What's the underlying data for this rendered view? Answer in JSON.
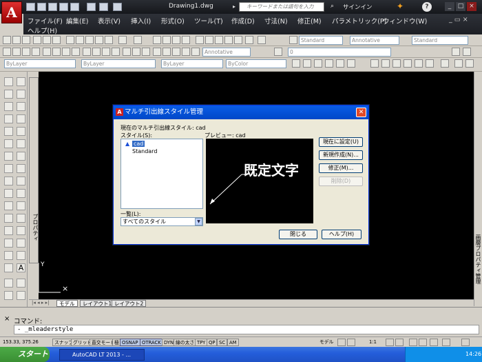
{
  "app": {
    "doc_title": "Drawing1.dwg",
    "search_placeholder": "キーワードまたは語句を入力",
    "signin": "サインイン",
    "logo_letter": "A"
  },
  "menu": {
    "items": [
      "ファイル(F)",
      "編集(E)",
      "表示(V)",
      "挿入(I)",
      "形式(O)",
      "ツール(T)",
      "作成(D)",
      "寸法(N)",
      "修正(M)",
      "パラメトリック(P)",
      "ウィンドウ(W)",
      "ヘルプ(H)"
    ]
  },
  "toolbars": {
    "styles": [
      "Standard",
      "Annotative",
      "Standard"
    ],
    "annotative_label": "Annotative",
    "layer_value": "0",
    "bylayer1": "ByLayer",
    "bylayer2": "ByLayer",
    "bylayer3": "ByLayer",
    "bycolor": "ByColor"
  },
  "properties_label": "プロパティ",
  "right_label": "画層プロパティ管理",
  "tabs": [
    "モデル",
    "レイアウト1",
    "レイアウト2"
  ],
  "command": {
    "prompt": "コマンド:",
    "input": "- _mleaderstyle"
  },
  "status": {
    "coords": "153.33, 375.26",
    "buttons": [
      "スナップ",
      "グリッド",
      "直交モード",
      "極",
      "OSNAP",
      "OTRACK",
      "DYN",
      "線の太さ",
      "TPY",
      "QP",
      "SC",
      "AM"
    ],
    "active": [
      "OSNAP",
      "OTRACK"
    ],
    "model_label": "モデル",
    "scale": "1:1"
  },
  "taskbar": {
    "start": "スタート",
    "task": "AutoCAD LT 2013 - ...",
    "time": "14:26"
  },
  "dialog": {
    "title": "マルチ引出線スタイル管理",
    "current_style_label": "現在のマルチ引出線スタイル: cad",
    "styles_label": "スタイル(S):",
    "styles": [
      "cad",
      "Standard"
    ],
    "selected_style": "cad",
    "preview_label": "プレビュー: cad",
    "preview_text": "既定文字",
    "list_label": "一覧(L):",
    "list_value": "すべてのスタイル",
    "btn_set_current": "現在に設定(U)",
    "btn_new": "新規作成(N)...",
    "btn_modify": "修正(M)...",
    "btn_delete": "削除(D)",
    "btn_close": "閉じる",
    "btn_help": "ヘルプ(H)"
  }
}
